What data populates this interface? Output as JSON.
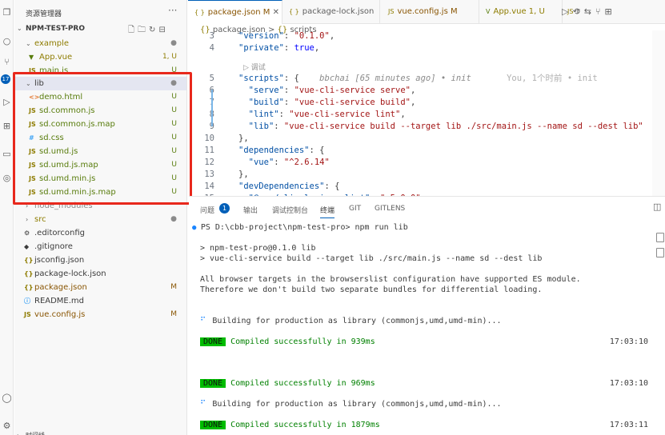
{
  "sidebar": {
    "title": "资源管理器",
    "more": "···",
    "project": "NPM-TEST-PRO",
    "items": [
      {
        "label": "example",
        "status": "●",
        "type": "folder"
      },
      {
        "label": "App.vue",
        "status": "1, U",
        "type": "vue"
      },
      {
        "label": "main.js",
        "status": "U",
        "type": "js"
      },
      {
        "label": "lib",
        "status": "●",
        "type": "folder"
      },
      {
        "label": "demo.html",
        "status": "U",
        "type": "html"
      },
      {
        "label": "sd.common.js",
        "status": "U",
        "type": "js"
      },
      {
        "label": "sd.common.js.map",
        "status": "U",
        "type": "js"
      },
      {
        "label": "sd.css",
        "status": "U",
        "type": "css"
      },
      {
        "label": "sd.umd.js",
        "status": "U",
        "type": "js"
      },
      {
        "label": "sd.umd.js.map",
        "status": "U",
        "type": "js"
      },
      {
        "label": "sd.umd.min.js",
        "status": "U",
        "type": "js"
      },
      {
        "label": "sd.umd.min.js.map",
        "status": "U",
        "type": "js"
      },
      {
        "label": "node_modules",
        "status": "",
        "type": "folder"
      },
      {
        "label": "src",
        "status": "●",
        "type": "folder"
      },
      {
        "label": ".editorconfig",
        "status": "",
        "type": "config"
      },
      {
        "label": ".gitignore",
        "status": "",
        "type": "git"
      },
      {
        "label": "jsconfig.json",
        "status": "",
        "type": "json"
      },
      {
        "label": "package-lock.json",
        "status": "",
        "type": "json"
      },
      {
        "label": "package.json",
        "status": "M",
        "type": "json"
      },
      {
        "label": "README.md",
        "status": "",
        "type": "md"
      },
      {
        "label": "vue.config.js",
        "status": "M",
        "type": "js"
      }
    ],
    "bottom_label": "时间线"
  },
  "tabs": [
    {
      "label": "package.json",
      "suffix": "M",
      "icon": "{ }"
    },
    {
      "label": "package-lock.json",
      "suffix": "",
      "icon": "{ }"
    },
    {
      "label": "vue.config.js",
      "suffix": "M",
      "icon": "JS"
    },
    {
      "label": "App.vue",
      "suffix": "1, U",
      "icon": "V"
    },
    {
      "label": "r",
      "suffix": "",
      "icon": "JS"
    }
  ],
  "breadcrumb": {
    "file": "package.json",
    "sep": ">",
    "node": "scripts"
  },
  "codelens": "▷ 调试",
  "code": {
    "lines": [
      {
        "n": "3",
        "parts": [
          [
            "k",
            "\"version\""
          ],
          [
            "p",
            ": "
          ],
          [
            "s",
            "\"0.1.0\""
          ],
          [
            "p",
            ","
          ]
        ]
      },
      {
        "n": "4",
        "parts": [
          [
            "k",
            "\"private\""
          ],
          [
            "p",
            ": "
          ],
          [
            "b",
            "true"
          ],
          [
            "p",
            ","
          ]
        ]
      },
      {
        "n": "5",
        "parts": [
          [
            "k",
            "\"scripts\""
          ],
          [
            "p",
            ": {    "
          ],
          [
            "blame",
            "bbchai [65 minutes ago] • init"
          ],
          [
            "hover",
            "       You, 1个时前 • init"
          ]
        ]
      },
      {
        "n": "6",
        "parts": [
          [
            "p",
            "  "
          ],
          [
            "k",
            "\"serve\""
          ],
          [
            "p",
            ": "
          ],
          [
            "s",
            "\"vue-cli-service serve\""
          ],
          [
            "p",
            ","
          ]
        ]
      },
      {
        "n": "7",
        "parts": [
          [
            "p",
            "  "
          ],
          [
            "k",
            "\"build\""
          ],
          [
            "p",
            ": "
          ],
          [
            "s",
            "\"vue-cli-service build\""
          ],
          [
            "p",
            ","
          ]
        ]
      },
      {
        "n": "8",
        "parts": [
          [
            "p",
            "  "
          ],
          [
            "k",
            "\"lint\""
          ],
          [
            "p",
            ": "
          ],
          [
            "s",
            "\"vue-cli-service lint\""
          ],
          [
            "p",
            ","
          ]
        ]
      },
      {
        "n": "9",
        "parts": [
          [
            "p",
            "  "
          ],
          [
            "k",
            "\"lib\""
          ],
          [
            "p",
            ": "
          ],
          [
            "s",
            "\"vue-cli-service build --target lib ./src/main.js --name sd --dest lib\""
          ]
        ]
      },
      {
        "n": "10",
        "parts": [
          [
            "p",
            "},"
          ]
        ]
      },
      {
        "n": "11",
        "parts": [
          [
            "k",
            "\"dependencies\""
          ],
          [
            "p",
            ": {"
          ]
        ]
      },
      {
        "n": "12",
        "parts": [
          [
            "p",
            "  "
          ],
          [
            "k",
            "\"vue\""
          ],
          [
            "p",
            ": "
          ],
          [
            "s",
            "\"^2.6.14\""
          ]
        ]
      },
      {
        "n": "13",
        "parts": [
          [
            "p",
            "},"
          ]
        ]
      },
      {
        "n": "14",
        "parts": [
          [
            "k",
            "\"devDependencies\""
          ],
          [
            "p",
            ": {"
          ]
        ]
      },
      {
        "n": "15",
        "parts": [
          [
            "p",
            "  "
          ],
          [
            "k",
            "\"@vue/cli-plugin-eslint\""
          ],
          [
            "p",
            ": "
          ],
          [
            "s",
            "\"~5.0.0\""
          ]
        ]
      }
    ]
  },
  "panel": {
    "tabs": [
      "问题",
      "输出",
      "调试控制台",
      "终端",
      "GIT",
      "GITLENS"
    ],
    "active_tab": "终端",
    "problems_count": "1",
    "terminal": [
      {
        "type": "prompt",
        "text": "PS D:\\cbb-project\\npm-test-pro> npm run lib"
      },
      {
        "type": "plain",
        "text": ""
      },
      {
        "type": "plain",
        "text": "> npm-test-pro@0.1.0 lib"
      },
      {
        "type": "plain",
        "text": "> vue-cli-service build --target lib ./src/main.js --name sd --dest lib"
      },
      {
        "type": "plain",
        "text": ""
      },
      {
        "type": "plain",
        "text": "All browser targets in the browserslist configuration have supported ES module."
      },
      {
        "type": "plain",
        "text": "Therefore we don't build two separate bundles for differential loading."
      },
      {
        "type": "plain",
        "text": ""
      },
      {
        "type": "plain",
        "text": ""
      },
      {
        "type": "building",
        "text": "Building for production as library (commonjs,umd,umd-min)..."
      },
      {
        "type": "plain",
        "text": ""
      },
      {
        "type": "done",
        "badge": "DONE",
        "text": "Compiled successfully in 939ms",
        "time": "17:03:10"
      },
      {
        "type": "plain",
        "text": ""
      },
      {
        "type": "plain",
        "text": ""
      },
      {
        "type": "plain",
        "text": ""
      },
      {
        "type": "done",
        "badge": "DONE",
        "text": "Compiled successfully in 969ms",
        "time": "17:03:10"
      },
      {
        "type": "plain",
        "text": ""
      },
      {
        "type": "building",
        "text": "Building for production as library (commonjs,umd,umd-min)..."
      },
      {
        "type": "plain",
        "text": ""
      },
      {
        "type": "done",
        "badge": "DONE",
        "text": "Compiled successfully in 1879ms",
        "time": "17:03:11"
      }
    ]
  },
  "colors": {
    "accent": "#005fb8",
    "highlight_box": "#e8281c",
    "done_badge": "#00bc00"
  }
}
